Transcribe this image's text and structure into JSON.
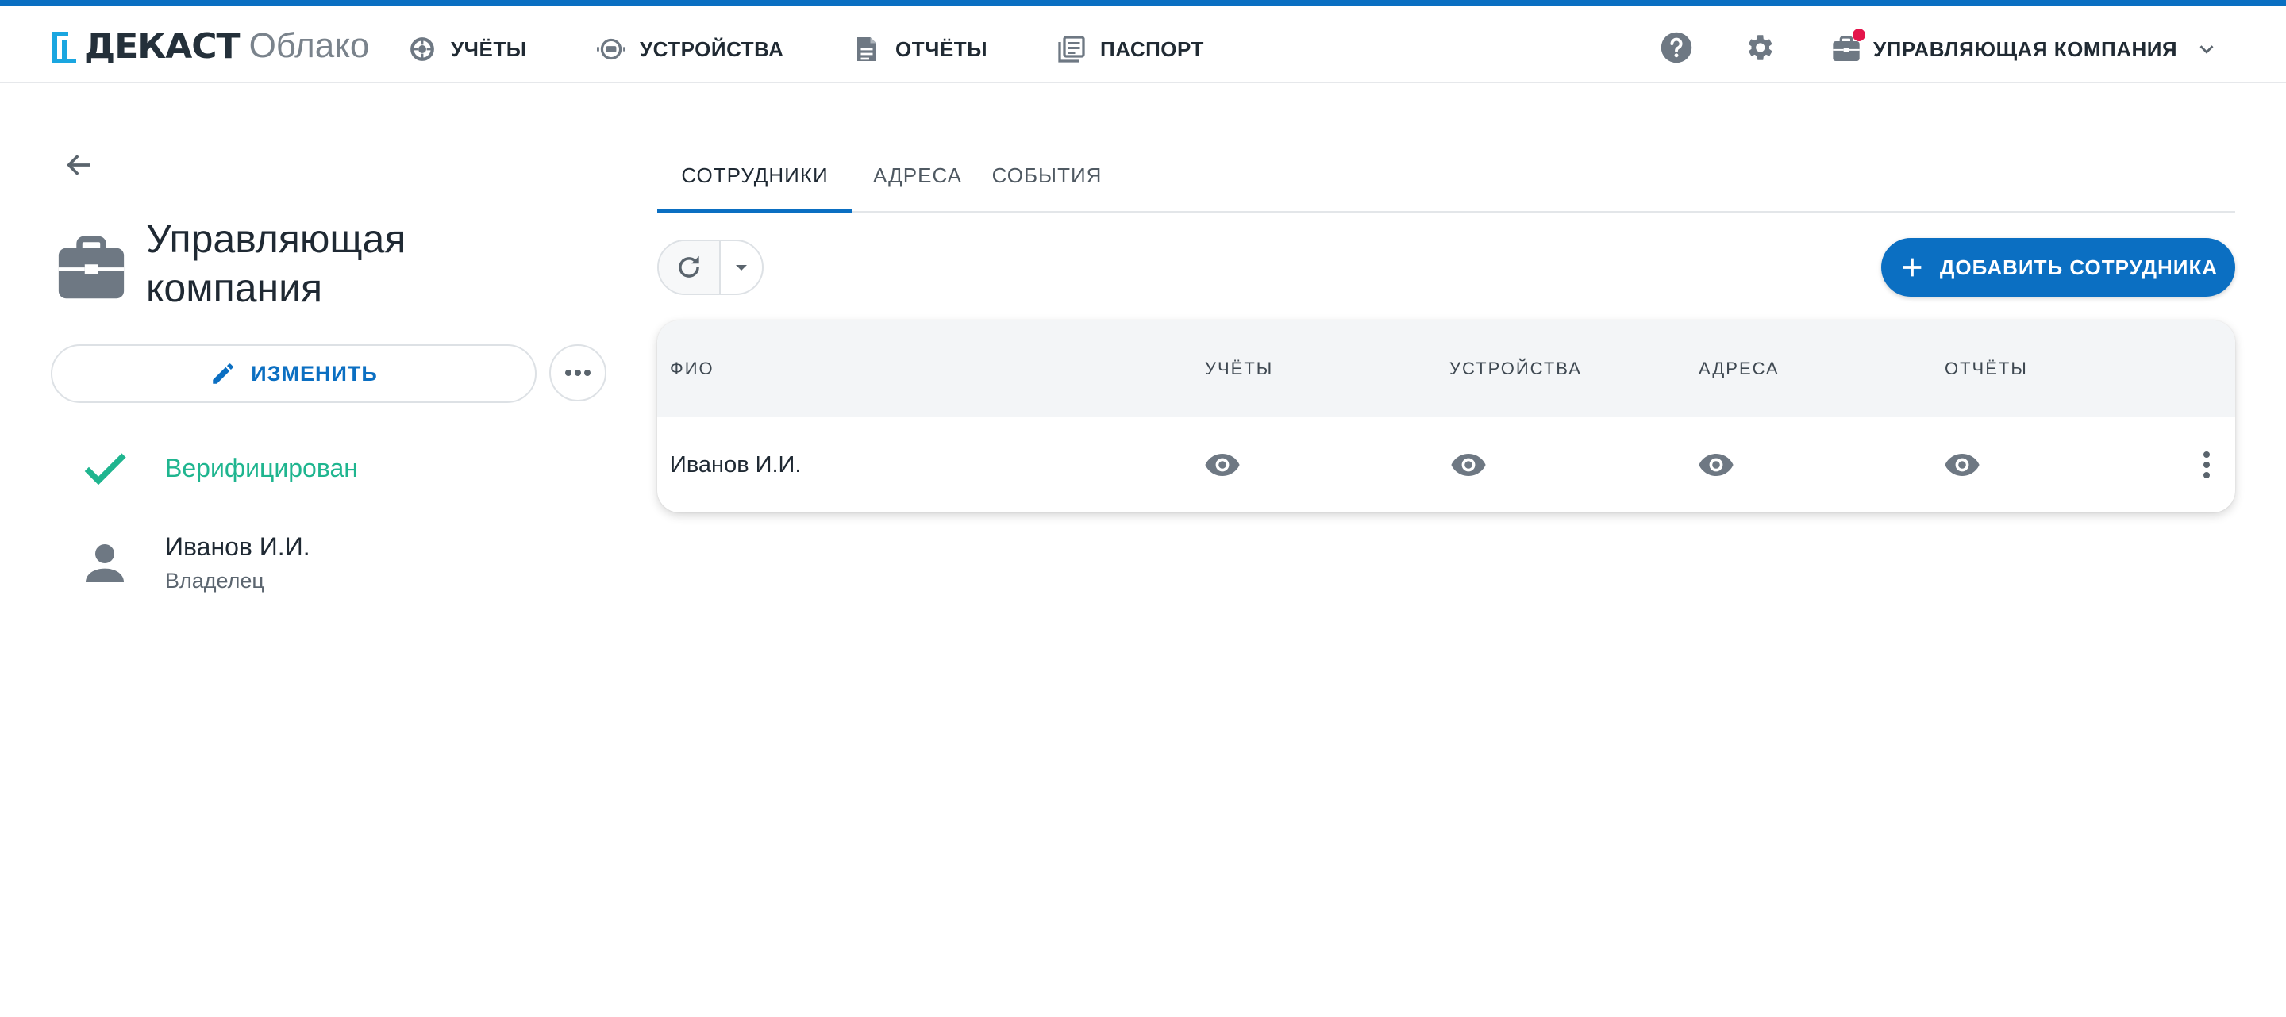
{
  "header": {
    "brand": "ДЕКАСТ",
    "product": "Облако",
    "nav": [
      {
        "label": "УЧЁТЫ",
        "icon": "meter-icon"
      },
      {
        "label": "УСТРОЙСТВА",
        "icon": "device-icon"
      },
      {
        "label": "ОТЧЁТЫ",
        "icon": "report-icon"
      },
      {
        "label": "ПАСПОРТ",
        "icon": "passport-icon"
      }
    ],
    "help_icon": "help-icon",
    "settings_icon": "gear-icon",
    "company_menu": {
      "label": "УПРАВЛЯЮЩАЯ КОМПАНИЯ",
      "icon": "briefcase-icon",
      "has_notification": true
    }
  },
  "sidebar": {
    "title": "Управляющая компания",
    "edit_label": "ИЗМЕНИТЬ",
    "verified_label": "Верифицирован",
    "owner": {
      "name": "Иванов И.И.",
      "role": "Владелец"
    }
  },
  "tabs": [
    {
      "label": "СОТРУДНИКИ",
      "active": true
    },
    {
      "label": "АДРЕСА",
      "active": false
    },
    {
      "label": "СОБЫТИЯ",
      "active": false
    }
  ],
  "toolbar": {
    "add_label": "ДОБАВИТЬ СОТРУДНИКА"
  },
  "table": {
    "columns": [
      "ФИО",
      "УЧЁТЫ",
      "УСТРОЙСТВА",
      "АДРЕСА",
      "ОТЧЁТЫ"
    ],
    "rows": [
      {
        "name": "Иванов И.И.",
        "permissions": [
          "view",
          "view",
          "view",
          "view"
        ]
      }
    ]
  },
  "colors": {
    "accent": "#0b6fc2",
    "verified": "#1fb58f",
    "notification": "#e4154b",
    "icon_gray": "#6e7883"
  }
}
